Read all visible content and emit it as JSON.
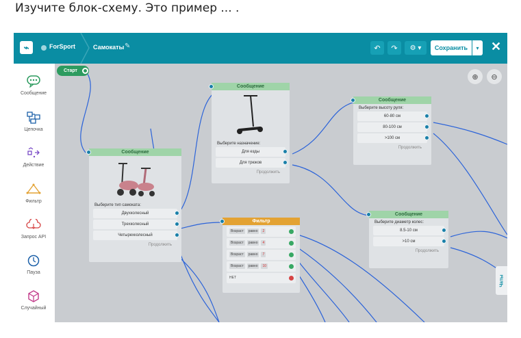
{
  "question": "Изучите блок-схему. Это пример ... .",
  "topbar": {
    "project": "ForSport",
    "flow_name": "Самокаты",
    "save_label": "Сохранить"
  },
  "sidebar": {
    "items": [
      {
        "label": "Сообщение",
        "icon": "message-icon"
      },
      {
        "label": "Цепочка",
        "icon": "chain-icon"
      },
      {
        "label": "Действие",
        "icon": "action-icon"
      },
      {
        "label": "Фильтр",
        "icon": "filter-icon"
      },
      {
        "label": "Запрос API",
        "icon": "api-icon"
      },
      {
        "label": "Пауза",
        "icon": "clock-icon"
      },
      {
        "label": "Случайный",
        "icon": "dice-icon"
      }
    ]
  },
  "canvas": {
    "start_label": "Старт",
    "chats_label": "Чаты",
    "node_scooter_type": {
      "title": "Сообщение",
      "prompt": "Выберите тип самоката:",
      "options": [
        "Двухколесный",
        "Трехколесный",
        "Четырехколесный"
      ],
      "continue": "Продолжить"
    },
    "node_purpose": {
      "title": "Сообщение",
      "prompt": "Выберите назначение:",
      "options": [
        "Для езды",
        "Для трюков"
      ],
      "continue": "Продолжить"
    },
    "node_height": {
      "title": "Сообщение",
      "prompt": "Выберите высоту руля:",
      "options": [
        "60-80 см",
        "80-100 см",
        ">100 см"
      ],
      "continue": "Продолжить"
    },
    "node_wheel": {
      "title": "Сообщение",
      "prompt": "Выберите диаметр колес:",
      "options": [
        "8.5-10 см",
        ">10 см"
      ],
      "continue": "Продолжить"
    },
    "node_filter": {
      "title": "Фильтр",
      "rows": [
        {
          "field": "Возраст",
          "op": "равно",
          "value": "2"
        },
        {
          "field": "Возраст",
          "op": "равно",
          "value": "4"
        },
        {
          "field": "Возраст",
          "op": "равно",
          "value": "7"
        },
        {
          "field": "Возраст",
          "op": "равно",
          "value": "10"
        }
      ],
      "else_label": "НЕТ"
    }
  },
  "colors": {
    "topbar": "#0a8da3",
    "edge": "#2b63d9",
    "start": "#2d9b5f",
    "filter_header": "#e3a233"
  }
}
